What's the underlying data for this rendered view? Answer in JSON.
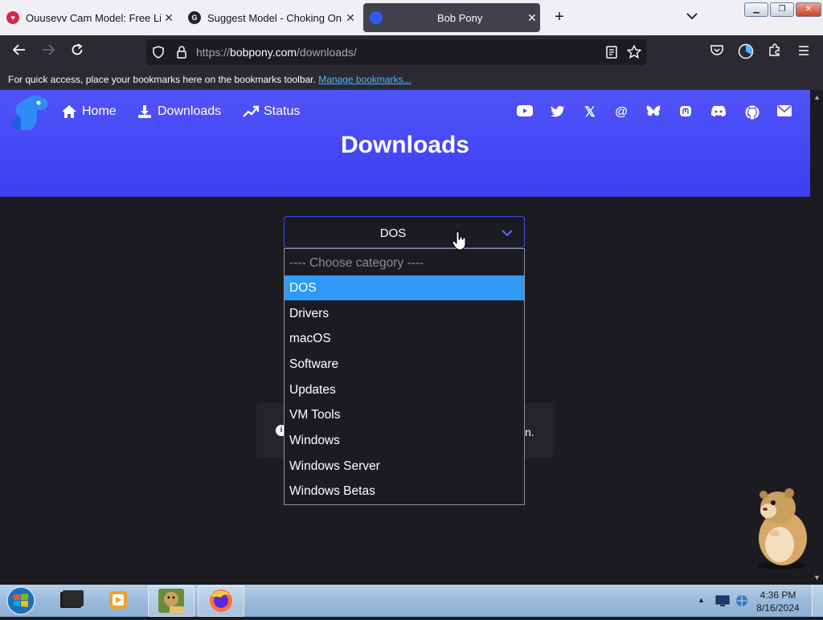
{
  "colors": {
    "accent": "#4547f5",
    "selected": "#2f9af5",
    "page_bg": "#1c1b22"
  },
  "tabs": [
    {
      "title": "Ouusevv Cam Model: Free Live",
      "favicon": "pinkred-heart-icon"
    },
    {
      "title": "Suggest Model - Choking On I",
      "favicon": "g-logo-icon"
    },
    {
      "title": "Bob Pony",
      "favicon": "bobpony-icon"
    }
  ],
  "address_bar": {
    "url": "https://bobpony.com/downloads/",
    "scheme": "https://",
    "host": "bobpony.com",
    "path": "/downloads/"
  },
  "bookmarks_bar": {
    "message": "For quick access, place your bookmarks here on the bookmarks toolbar.",
    "link": "Manage bookmarks..."
  },
  "site": {
    "nav": [
      {
        "label": "Home",
        "icon": "home-icon"
      },
      {
        "label": "Downloads",
        "icon": "download-icon"
      },
      {
        "label": "Status",
        "icon": "trend-icon"
      }
    ],
    "social_icons": [
      "youtube-icon",
      "twitter-icon",
      "x-icon",
      "threads-icon",
      "bluesky-icon",
      "mastodon-icon",
      "discord-icon",
      "github-icon",
      "email-icon"
    ],
    "page_title": "Downloads"
  },
  "category_select": {
    "value": "DOS",
    "options": [
      {
        "label": "---- Choose category ----",
        "placeholder": true
      },
      {
        "label": "DOS",
        "selected": true
      },
      {
        "label": "Drivers"
      },
      {
        "label": "macOS"
      },
      {
        "label": "Software"
      },
      {
        "label": "Updates"
      },
      {
        "label": "VM Tools"
      },
      {
        "label": "Windows"
      },
      {
        "label": "Windows Server"
      },
      {
        "label": "Windows Betas"
      }
    ]
  },
  "info_panel": {
    "tail_text": "n."
  },
  "taskbar": {
    "time": "4:36 PM",
    "date": "8/16/2024"
  }
}
